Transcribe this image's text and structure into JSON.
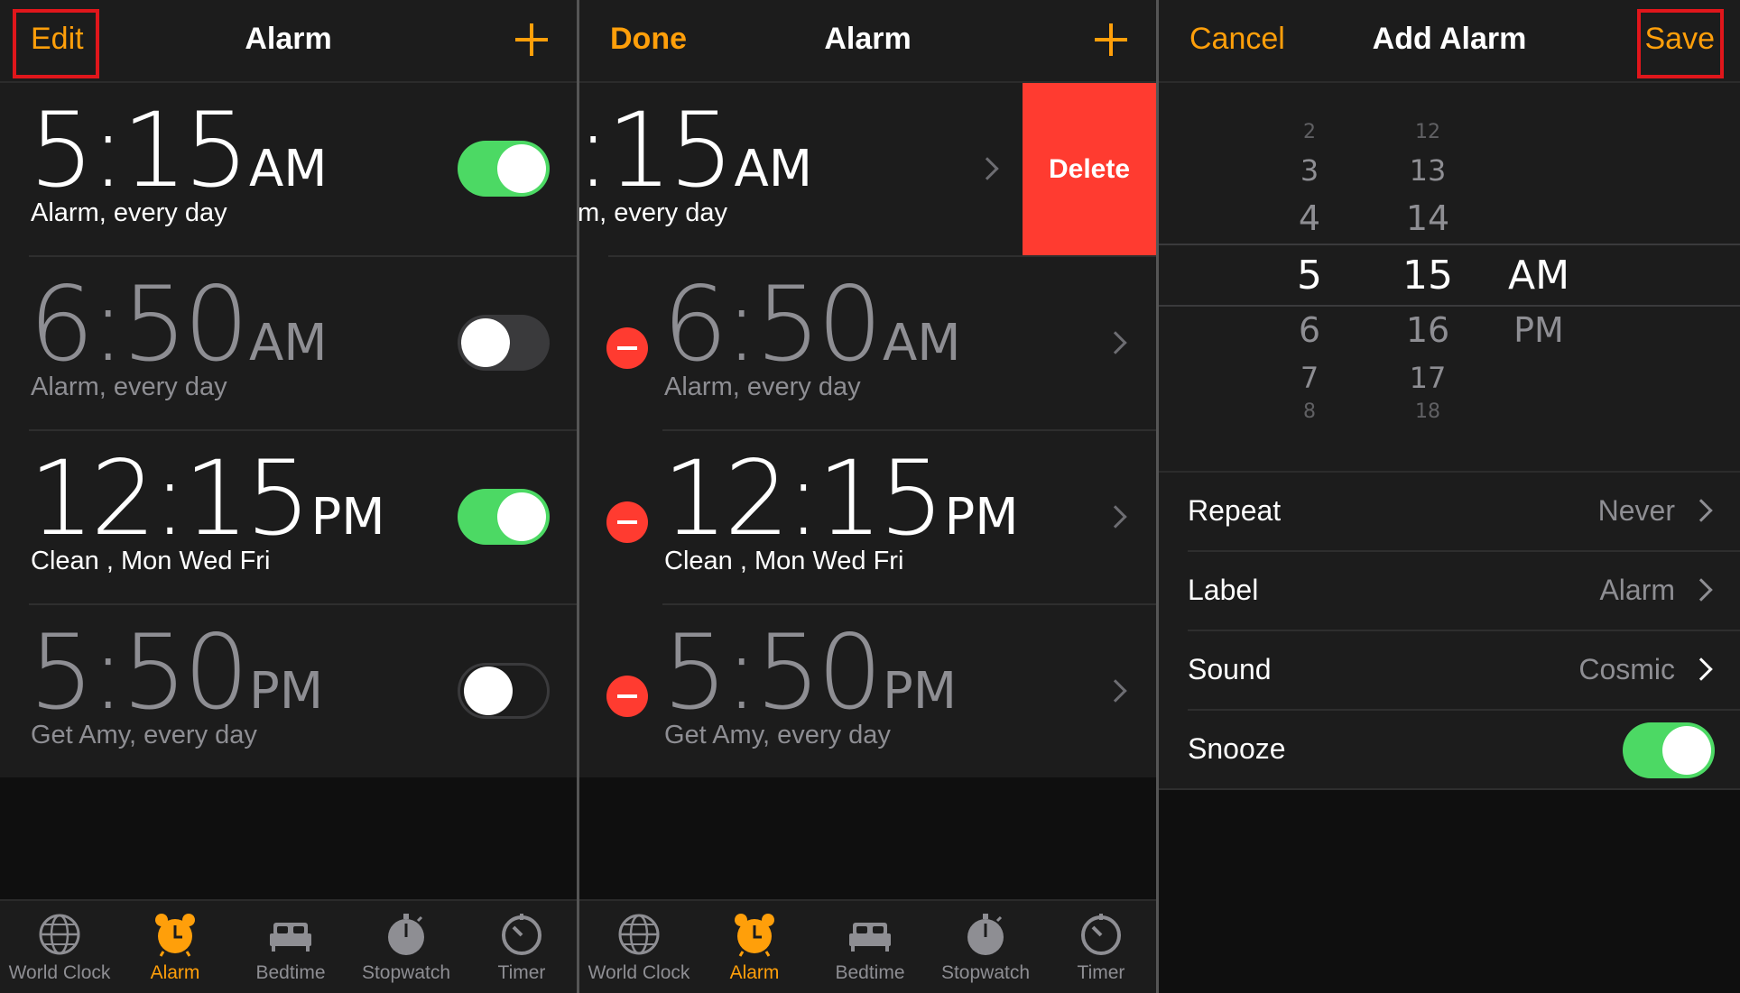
{
  "colors": {
    "accent": "#ff9f0a",
    "toggle_on": "#4cd964",
    "destructive": "#ff3b30",
    "highlight_box": "#e0161b"
  },
  "panel1": {
    "nav": {
      "left": "Edit",
      "title": "Alarm"
    },
    "alarms": [
      {
        "time": "5:15",
        "ampm": "AM",
        "label": "Alarm, every day",
        "enabled": true
      },
      {
        "time": "6:50",
        "ampm": "AM",
        "label": "Alarm, every day",
        "enabled": false
      },
      {
        "time": "12:15",
        "ampm": "PM",
        "label": "Clean , Mon Wed Fri",
        "enabled": true
      },
      {
        "time": "5:50",
        "ampm": "PM",
        "label": "Get Amy, every day",
        "enabled": false
      }
    ]
  },
  "panel2": {
    "nav": {
      "left": "Done",
      "title": "Alarm"
    },
    "swiped_time": ":15",
    "swiped_ampm": "AM",
    "swiped_label": "m, every day",
    "delete_label": "Delete",
    "alarms": [
      {
        "time": "6:50",
        "ampm": "AM",
        "label": "Alarm, every day"
      },
      {
        "time": "12:15",
        "ampm": "PM",
        "label": "Clean , Mon Wed Fri"
      },
      {
        "time": "5:50",
        "ampm": "PM",
        "label": "Get Amy, every day"
      }
    ]
  },
  "panel3": {
    "nav": {
      "left": "Cancel",
      "title": "Add Alarm",
      "right": "Save"
    },
    "picker": {
      "hours": [
        "2",
        "3",
        "4",
        "5",
        "6",
        "7",
        "8"
      ],
      "minutes": [
        "12",
        "13",
        "14",
        "15",
        "16",
        "17",
        "18"
      ],
      "periods": [
        "AM",
        "PM"
      ],
      "selected": {
        "hour": "5",
        "minute": "15",
        "period": "AM"
      }
    },
    "settings": [
      {
        "label": "Repeat",
        "value": "Never"
      },
      {
        "label": "Label",
        "value": "Alarm"
      },
      {
        "label": "Sound",
        "value": "Cosmic"
      },
      {
        "label": "Snooze",
        "toggle": true
      }
    ]
  },
  "tabs": [
    {
      "label": "World Clock",
      "icon": "globe-icon",
      "active": false
    },
    {
      "label": "Alarm",
      "icon": "alarm-clock-icon",
      "active": true
    },
    {
      "label": "Bedtime",
      "icon": "bed-icon",
      "active": false
    },
    {
      "label": "Stopwatch",
      "icon": "stopwatch-icon",
      "active": false
    },
    {
      "label": "Timer",
      "icon": "timer-icon",
      "active": false
    }
  ]
}
